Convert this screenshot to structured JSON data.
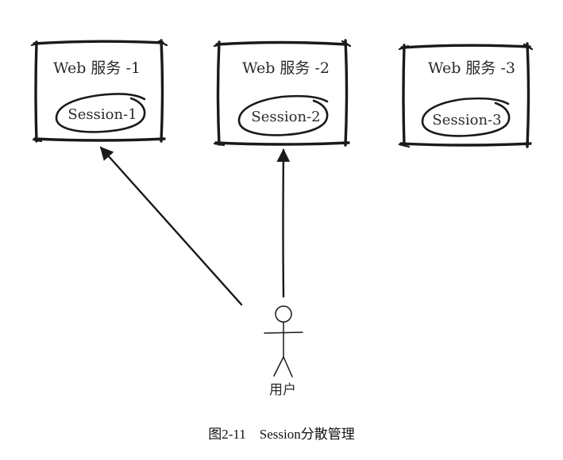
{
  "services": [
    {
      "title": "Web 服务 -1",
      "session": "Session-1"
    },
    {
      "title": "Web 服务 -2",
      "session": "Session-2"
    },
    {
      "title": "Web 服务 -3",
      "session": "Session-3"
    }
  ],
  "user": {
    "label": "用户"
  },
  "caption": "图2-11    Session分散管理"
}
